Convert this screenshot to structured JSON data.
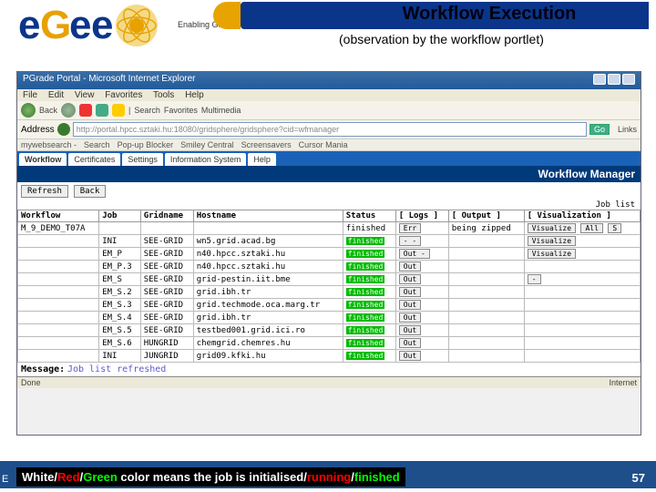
{
  "header": {
    "tagline": "Enabling Grids for E-sciencE",
    "title": "Workflow Execution",
    "subtitle": "(observation by the workflow portlet)"
  },
  "browser": {
    "window_title": "PGrade Portal - Microsoft Internet Explorer",
    "menu": [
      "File",
      "Edit",
      "View",
      "Favorites",
      "Tools",
      "Help"
    ],
    "toolbar": {
      "back": "Back",
      "search": "Search",
      "favorites": "Favorites",
      "media": "Multimedia"
    },
    "address_label": "Address",
    "address_value": "http://portal.hpcc.sztaki.hu:18080/gridsphere/gridsphere?cid=wfmanager",
    "go": "Go",
    "links": "Links",
    "searchbar": {
      "brand": "mywebsearch -",
      "submit": "Search",
      "blocker": "Pop-up Blocker",
      "smiley": "Smiley Central",
      "screensavers": "Screensavers",
      "cursor": "Cursor Mania"
    }
  },
  "tabs": [
    "Workflow",
    "Certificates",
    "Settings",
    "Information System",
    "Help"
  ],
  "wm_title": "Workflow Manager",
  "buttons": {
    "refresh": "Refresh",
    "back": "Back"
  },
  "joblist_label": "Job list",
  "table": {
    "cols": [
      "Workflow",
      "Job",
      "Gridname",
      "Hostname",
      "Status",
      "[ Logs ]",
      "[ Output ]",
      "[ Visualization ]"
    ],
    "hdr2": {
      "status": "finished",
      "logs": "Err",
      "output": "being zipped",
      "viz": [
        "Visualize",
        "All",
        "S"
      ]
    },
    "wf": "M_9_DEMO_T07A",
    "rows": [
      {
        "job": "INI",
        "grid": "SEE-GRID",
        "host": "wn5.grid.acad.bg",
        "status": "finished",
        "logs": "- -",
        "viz": "Visualize"
      },
      {
        "job": "EM_P",
        "grid": "SEE-GRID",
        "host": "n40.hpcc.sztaki.hu",
        "status": "finished",
        "logs": "Out -",
        "viz": "Visualize"
      },
      {
        "job": "EM_P.3",
        "grid": "SEE-GRID",
        "host": "n40.hpcc.sztaki.hu",
        "status": "finished",
        "logs": "Out",
        "viz": ""
      },
      {
        "job": "EM_S",
        "grid": "SEE-GRID",
        "host": "grid-pestin.iit.bme",
        "status": "finished",
        "logs": "Out",
        "viz": "-"
      },
      {
        "job": "EM_S.2",
        "grid": "SEE-GRID",
        "host": "grid.ibh.tr",
        "status": "finished",
        "logs": "Out",
        "viz": ""
      },
      {
        "job": "EM_S.3",
        "grid": "SEE-GRID",
        "host": "grid.techmode.oca.marg.tr",
        "status": "finished",
        "logs": "Out",
        "viz": ""
      },
      {
        "job": "EM_S.4",
        "grid": "SEE-GRID",
        "host": "grid.ibh.tr",
        "status": "finished",
        "logs": "Out",
        "viz": ""
      },
      {
        "job": "EM_S.5",
        "grid": "SEE-GRID",
        "host": "testbed001.grid.ici.ro",
        "status": "finished",
        "logs": "Out",
        "viz": ""
      },
      {
        "job": "EM_S.6",
        "grid": "HUNGRID",
        "host": "chemgrid.chemres.hu",
        "status": "finished",
        "logs": "Out",
        "viz": ""
      },
      {
        "job": "INI",
        "grid": "JUNGRID",
        "host": "grid09.kfki.hu",
        "status": "finished",
        "logs": "Out",
        "viz": ""
      }
    ]
  },
  "message": {
    "label": "Message:",
    "value": "Job list refreshed"
  },
  "statusbar": {
    "done": "Done",
    "zone": "Internet"
  },
  "legend": {
    "p1": "White",
    "p2": "/",
    "p3": "Red",
    "p4": "/",
    "p5": "Green",
    "rest": " color means the job is ",
    "q1": "initialised",
    "q2": "/",
    "q3": "running",
    "q4": "/",
    "q5": "finished"
  },
  "page_number": "57",
  "eleft": "E"
}
